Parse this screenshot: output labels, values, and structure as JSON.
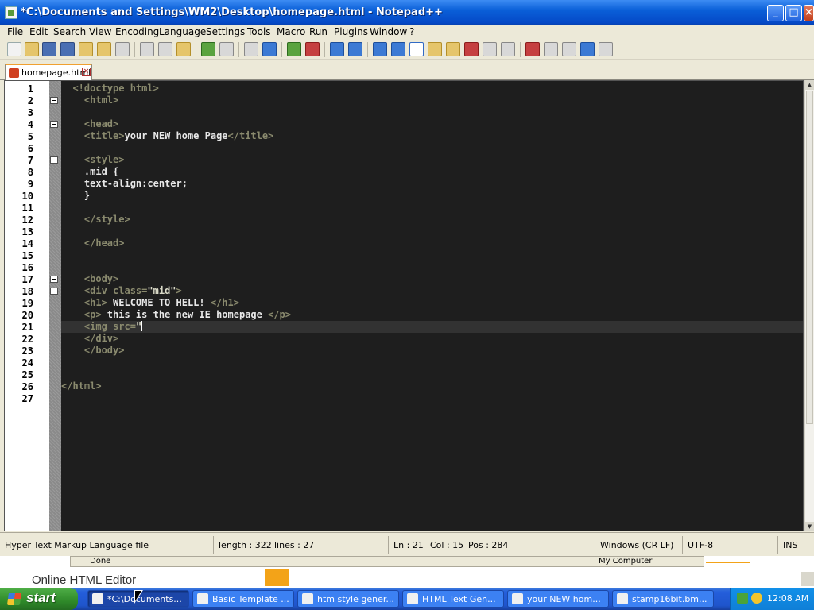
{
  "window": {
    "title": "*C:\\Documents and Settings\\WM2\\Desktop\\homepage.html - Notepad++",
    "controls": [
      "minimize",
      "maximize",
      "close"
    ]
  },
  "menu": [
    "File",
    "Edit",
    "Search",
    "View",
    "Encoding",
    "Language",
    "Settings",
    "Tools",
    "Macro",
    "Run",
    "Plugins",
    "Window",
    "?"
  ],
  "toolbar": {
    "icons": [
      "new-file-icon",
      "open-file-icon",
      "save-icon",
      "save-all-icon",
      "close-icon",
      "close-all-icon",
      "print-icon",
      "cut-icon",
      "copy-icon",
      "paste-icon",
      "undo-icon",
      "redo-icon",
      "find-icon",
      "replace-icon",
      "zoom-in-icon",
      "zoom-out-icon",
      "sync-vertical-icon",
      "sync-horizontal-icon",
      "word-wrap-icon",
      "show-all-chars-icon",
      "indent-guide-icon",
      "user-lang-icon",
      "doc-map-icon",
      "function-list-icon",
      "folder-workspace-icon",
      "monitor-icon",
      "record-macro-icon",
      "stop-record-icon",
      "playback-icon",
      "run-macro-multiple-icon",
      "save-macro-icon"
    ]
  },
  "tabs": [
    {
      "label": "homepage.html",
      "active": true,
      "modified": true
    }
  ],
  "editor": {
    "line_numbers": [
      "1",
      "2",
      "3",
      "4",
      "5",
      "6",
      "7",
      "8",
      "9",
      "10",
      "11",
      "12",
      "13",
      "14",
      "15",
      "16",
      "17",
      "18",
      "19",
      "20",
      "21",
      "22",
      "23",
      "24",
      "25",
      "26",
      "27"
    ],
    "current_line": 21,
    "fold_markers": [
      2,
      4,
      7,
      17,
      18
    ],
    "lines": [
      [
        {
          "t": "tag",
          "v": "  <!doctype html>"
        }
      ],
      [
        {
          "t": "tag",
          "v": "    <html>"
        }
      ],
      [],
      [
        {
          "t": "tag",
          "v": "    <head>"
        }
      ],
      [
        {
          "t": "tag",
          "v": "    <title>"
        },
        {
          "t": "txt",
          "v": "your NEW home Page"
        },
        {
          "t": "tag",
          "v": "</title>"
        }
      ],
      [],
      [
        {
          "t": "tag",
          "v": "    <style>"
        }
      ],
      [
        {
          "t": "txt",
          "v": "    .mid {"
        }
      ],
      [
        {
          "t": "txt",
          "v": "    text-align:center;"
        }
      ],
      [
        {
          "t": "txt",
          "v": "    }"
        }
      ],
      [],
      [
        {
          "t": "tag",
          "v": "    </style>"
        }
      ],
      [],
      [
        {
          "t": "tag",
          "v": "    </head>"
        }
      ],
      [],
      [],
      [
        {
          "t": "tag",
          "v": "    <body>"
        }
      ],
      [
        {
          "t": "tag",
          "v": "    <div "
        },
        {
          "t": "attr",
          "v": "class"
        },
        {
          "t": "tag",
          "v": "="
        },
        {
          "t": "val",
          "v": "\"mid\""
        },
        {
          "t": "tag",
          "v": ">"
        }
      ],
      [
        {
          "t": "tag",
          "v": "    <h1>"
        },
        {
          "t": "txt",
          "v": " WELCOME TO HELL! "
        },
        {
          "t": "tag",
          "v": "</h1>"
        }
      ],
      [
        {
          "t": "tag",
          "v": "    <p>"
        },
        {
          "t": "txt",
          "v": " this is the new IE homepage "
        },
        {
          "t": "tag",
          "v": "</p>"
        }
      ],
      [
        {
          "t": "tag",
          "v": "    <img "
        },
        {
          "t": "attr",
          "v": "src"
        },
        {
          "t": "tag",
          "v": "="
        },
        {
          "t": "val",
          "v": "\""
        }
      ],
      [
        {
          "t": "tag",
          "v": "    </div>"
        }
      ],
      [
        {
          "t": "tag",
          "v": "    </body>"
        }
      ],
      [],
      [],
      [
        {
          "t": "tag",
          "v": "</html>"
        }
      ],
      []
    ]
  },
  "statusbar": {
    "filetype": "Hyper Text Markup Language file",
    "length": "length : 322",
    "lines": "lines : 27",
    "ln": "Ln : 21",
    "col": "Col : 15",
    "pos": "Pos : 284",
    "eol": "Windows (CR LF)",
    "encoding": "UTF-8",
    "mode": "INS"
  },
  "background_window": {
    "status_done": "Done",
    "status_zone": "My Computer",
    "heading": "Online HTML Editor"
  },
  "taskbar": {
    "start_label": "start",
    "tasks": [
      {
        "label": "*C:\\Documents...",
        "active": true
      },
      {
        "label": "Basic Template ...",
        "active": false
      },
      {
        "label": "htm style gener...",
        "active": false
      },
      {
        "label": "HTML Text Gen...",
        "active": false
      },
      {
        "label": "your NEW hom...",
        "active": false
      },
      {
        "label": "stamp16bit.bm...",
        "active": false
      }
    ],
    "clock": "12:08 AM"
  },
  "colors": {
    "editor_bg": "#1e1e1e",
    "tag": "#8a8a6e",
    "text": "#e8e8e8",
    "current_line": "#323232",
    "xp_blue": "#0a5fd8"
  }
}
